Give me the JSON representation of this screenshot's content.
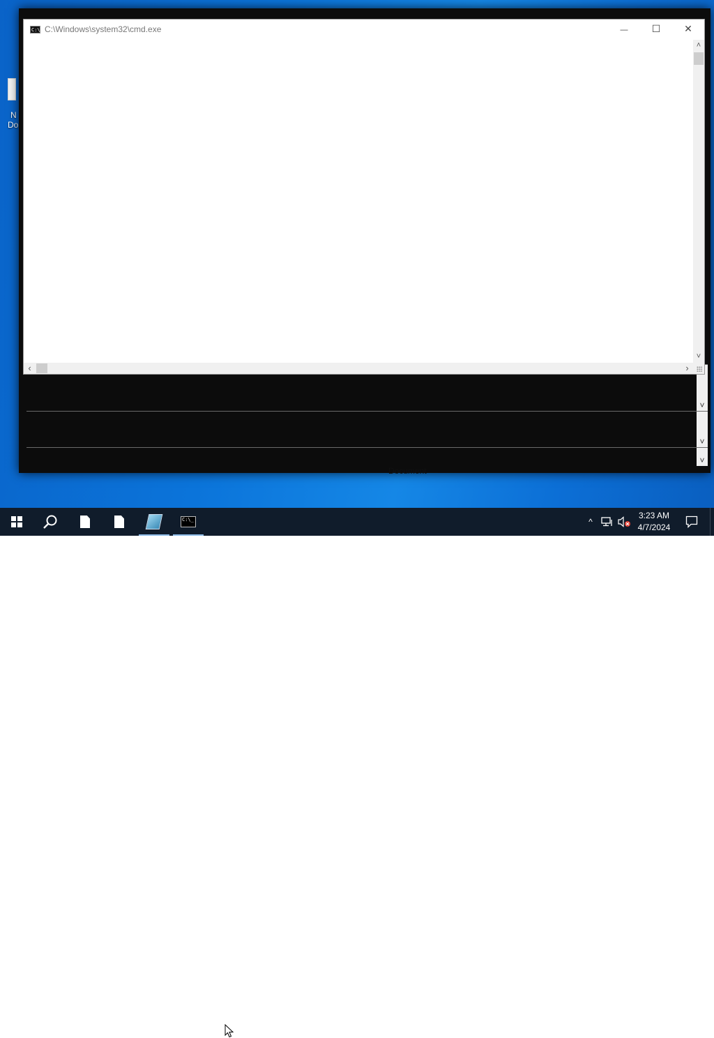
{
  "cmd_window": {
    "title": "C:\\Windows\\system32\\cmd.exe",
    "icon_text": "C:\\_",
    "minimize_glyph": "—",
    "maximize_glyph": "☐",
    "close_glyph": "✕",
    "scroll_up_glyph": "˄",
    "scroll_down_glyph": "˅",
    "scroll_left_glyph": "‹",
    "scroll_right_glyph": "›"
  },
  "back_window": {
    "pane_scroll_glyph": "˅"
  },
  "desktop": {
    "icon_partial_label_1": "N",
    "icon_partial_label_2": "Do",
    "behind_label": "Document"
  },
  "taskbar": {
    "clock_time": "3:23 AM",
    "clock_date": "4/7/2024",
    "tray_chevron_glyph": "^",
    "colors": {
      "background": "#101c2b",
      "active_indicator": "#8bb9e6"
    },
    "icons": [
      "start-icon",
      "search-icon",
      "document-icon",
      "document-icon",
      "notepad-icon",
      "command-prompt-icon",
      "network-icon",
      "volume-muted-icon",
      "notification-icon"
    ]
  }
}
